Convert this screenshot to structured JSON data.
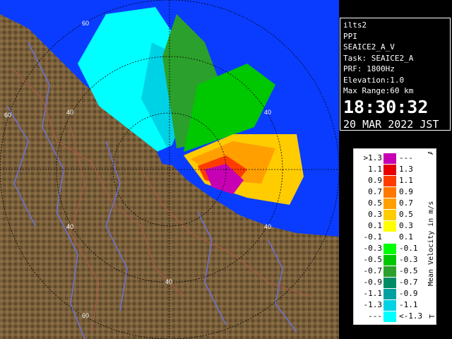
{
  "radar_map": {
    "range_ring_labels": [
      "60",
      "40",
      "60",
      "40",
      "40",
      "40",
      "40",
      "60"
    ],
    "colors": {
      "land": "#7a5f3a",
      "sea": "#0a3cff",
      "rivers": "#6b74d8",
      "roads": "#b2594a",
      "grid": "#000000"
    }
  },
  "info_panel": {
    "site": "ilts2",
    "product": "PPI",
    "scan": "SEAICE2_A_V",
    "task": "Task: SEAICE2_A",
    "prf": "PRF: 1800Hz",
    "elevation": "Elevation:1.0",
    "max_range": "Max Range:60 km",
    "time": "18:30:32",
    "date": "20 MAR 2022 JST"
  },
  "legend": {
    "unit_label": "Mean Velocity in m/s",
    "top_marker": "A",
    "bottom_marker": "T",
    "rows": [
      {
        "left": ">1.3",
        "right": "---",
        "color": "#c800b4"
      },
      {
        "left": "1.1",
        "right": "1.3",
        "color": "#e80000"
      },
      {
        "left": "0.9",
        "right": "1.1",
        "color": "#ff3c00"
      },
      {
        "left": "0.7",
        "right": "0.9",
        "color": "#ff7800"
      },
      {
        "left": "0.5",
        "right": "0.7",
        "color": "#ffa000"
      },
      {
        "left": "0.3",
        "right": "0.5",
        "color": "#ffcc00"
      },
      {
        "left": "0.1",
        "right": "0.3",
        "color": "#ffff00"
      },
      {
        "left": "-0.1",
        "right": "0.1",
        "color": "#ffffff"
      },
      {
        "left": "-0.3",
        "right": "-0.1",
        "color": "#00ff00"
      },
      {
        "left": "-0.5",
        "right": "-0.3",
        "color": "#00c800"
      },
      {
        "left": "-0.7",
        "right": "-0.5",
        "color": "#2ca02c"
      },
      {
        "left": "-0.9",
        "right": "-0.7",
        "color": "#008c64"
      },
      {
        "left": "-1.1",
        "right": "-0.9",
        "color": "#00a0a0"
      },
      {
        "left": "-1.3",
        "right": "-1.1",
        "color": "#00d2e6"
      },
      {
        "left": "---",
        "right": "<-1.3",
        "color": "#00ffff"
      }
    ]
  }
}
